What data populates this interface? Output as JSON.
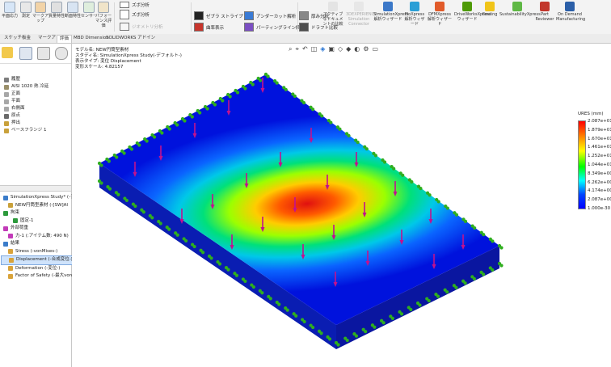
{
  "ribbon": {
    "items_left": [
      "平面応力",
      "測定",
      "マークアップ",
      "質量特性",
      "断面特性",
      "センサー",
      "パフォーマンス評価"
    ],
    "mid_rows": [
      {
        "label": "ゼブラ ストライプ",
        "icon": "zebra-stripes-icon"
      },
      {
        "label": "曲率表示",
        "icon": "curvature-icon"
      },
      {
        "label": "アンダーカット解析",
        "icon": "undercut-icon"
      },
      {
        "label": "パーティングライン解析",
        "icon": "parting-line-icon"
      },
      {
        "label": "厚み分析",
        "icon": "thickness-icon"
      },
      {
        "label": "ドラフト比較",
        "icon": "compare-icon"
      }
    ],
    "top_small": [
      "ズボ分析",
      "ジオメトリ分析"
    ],
    "items_right": [
      {
        "label": "アクティブなドキュメントの比較",
        "dim": false
      },
      {
        "label": "3DEXPERIENCE Simulation Connector",
        "dim": true
      },
      {
        "label": "SimulationXpress 解析ウィザード",
        "dim": false
      },
      {
        "label": "FloXpress 解析ウィザード",
        "dim": false
      },
      {
        "label": "DFMXpress 解析ウィザード",
        "dim": false
      },
      {
        "label": "DriveWorksXpress ウィザード",
        "dim": false
      },
      {
        "label": "Costing",
        "dim": false
      },
      {
        "label": "SustainabilityXpress",
        "dim": false
      },
      {
        "label": "Part Reviewer",
        "dim": false
      },
      {
        "label": "On Demand Manufacturing",
        "dim": false
      }
    ]
  },
  "tabs": [
    "スケッチ",
    "板金",
    "マークアップ",
    "評価",
    "MBD Dimension",
    "SOLIDWORKS アドイン"
  ],
  "active_tab": 3,
  "tree_top": [
    {
      "label": "履歴",
      "color": "#7d7d7d"
    },
    {
      "label": "AISI 1020 熱 冷延",
      "color": "#9a8f6a"
    },
    {
      "label": "正面",
      "color": "#a7a7a7"
    },
    {
      "label": "平面",
      "color": "#a7a7a7"
    },
    {
      "label": "右側面",
      "color": "#a7a7a7"
    },
    {
      "label": "原点",
      "color": "#6a6a6a"
    },
    {
      "label": "押出",
      "color": "#c9a13b"
    },
    {
      "label": "ベースフランジ 1",
      "color": "#c9a13b"
    }
  ],
  "tree_bottom": [
    {
      "label": "SimulationXpress Study* (-デフォルト-)",
      "color": "#3b7cc9",
      "indent": 0
    },
    {
      "label": "NEW円筒型素材 (-[SW]AI",
      "color": "#c9a13b",
      "indent": 1
    },
    {
      "label": "拘束",
      "color": "#2d9a3c",
      "indent": 0
    },
    {
      "label": "固定-1",
      "color": "#2d9a3c",
      "indent": 2
    },
    {
      "label": "外部荷重",
      "color": "#c23ab8",
      "indent": 0
    },
    {
      "label": "力-1 (:アイテム数: 490 N)",
      "color": "#c23ab8",
      "indent": 1
    },
    {
      "label": "結果",
      "color": "#3b7cc9",
      "indent": 0
    },
    {
      "label": "Stress (-vonMises-)",
      "color": "#d9a33a",
      "indent": 1
    },
    {
      "label": "Displacement (-合成変位-)",
      "color": "#d9a33a",
      "indent": 1,
      "selected": true
    },
    {
      "label": "Deformation (-変位-)",
      "color": "#d9a33a",
      "indent": 1
    },
    {
      "label": "Factor of Safety (-最大von M",
      "color": "#d9a33a",
      "indent": 1
    }
  ],
  "info": [
    "モデル名: NEW円筒型素材",
    "スタディ名: SimulationXpress Study(-デフォルト-)",
    "表示タイプ: 変位 Displacement",
    "変形スケール: 4.82157"
  ],
  "legend": {
    "title": "URES (mm)",
    "values": [
      "2.087e+01",
      "1.879e+01",
      "1.670e+01",
      "1.461e+01",
      "1.252e+01",
      "1.044e+01",
      "8.349e+00",
      "6.262e+00",
      "4.174e+00",
      "2.087e+00",
      "1.000e-30"
    ]
  },
  "colors": {
    "accent": "#1f6fd1",
    "fringe_max": "#ff0000",
    "fringe_min": "#0000ff",
    "fixture": "#2fae1f",
    "load_arrow": "#c2128f"
  }
}
